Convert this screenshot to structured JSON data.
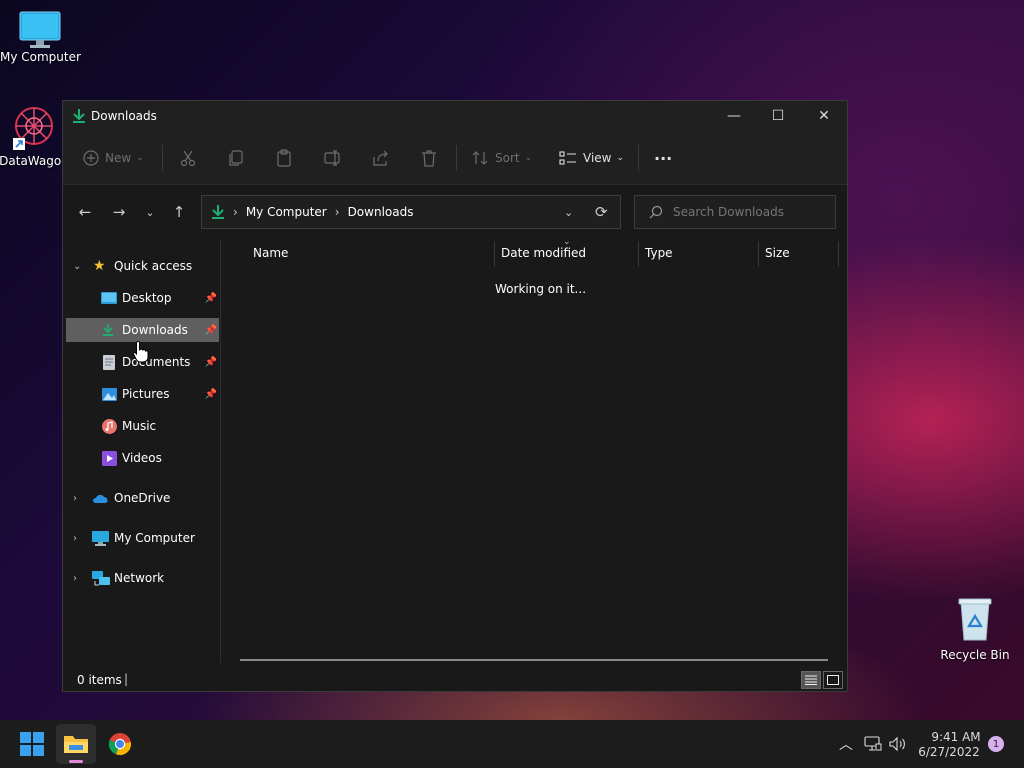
{
  "desktop": {
    "icons": [
      {
        "label": "My Computer"
      },
      {
        "label": "DataWagon"
      },
      {
        "label": "Recycle Bin"
      }
    ]
  },
  "window": {
    "title": "Downloads",
    "controls": {
      "minimize": "—",
      "maximize": "☐",
      "close": "✕"
    },
    "toolbar": {
      "new_label": "New",
      "sort_label": "Sort",
      "view_label": "View",
      "more_label": "···"
    },
    "address": {
      "crumbs": [
        "My Computer",
        "Downloads"
      ],
      "sep": "›"
    },
    "search": {
      "placeholder": "Search Downloads"
    },
    "sidebar": {
      "quick_access": "Quick access",
      "items": [
        {
          "label": "Desktop",
          "pinned": true
        },
        {
          "label": "Downloads",
          "pinned": true,
          "selected": true
        },
        {
          "label": "Documents",
          "pinned": true
        },
        {
          "label": "Pictures",
          "pinned": true
        },
        {
          "label": "Music"
        },
        {
          "label": "Videos"
        }
      ],
      "onedrive": "OneDrive",
      "my_computer": "My Computer",
      "network": "Network"
    },
    "columns": [
      "Name",
      "Date modified",
      "Type",
      "Size"
    ],
    "status_message": "Working on it...",
    "status_bar": {
      "items_count": "0 items",
      "divider": "|"
    }
  },
  "taskbar": {
    "time": "9:41 AM",
    "date": "6/27/2022",
    "notification_count": "1"
  },
  "colors": {
    "accent_green": "#1fae74",
    "selection": "#5f5f5f",
    "window_bg": "#191919"
  }
}
